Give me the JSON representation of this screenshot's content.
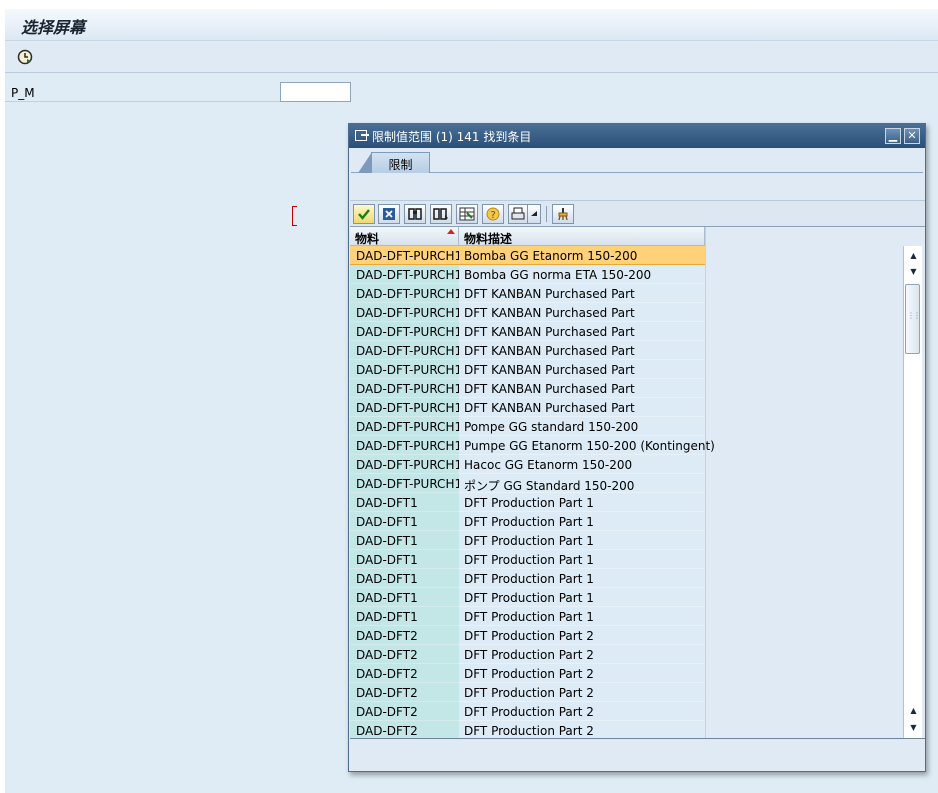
{
  "screen": {
    "title": "选择屏幕",
    "field_label": "P_M",
    "field_value": ""
  },
  "dialog": {
    "title": "限制值范围 (1)  141 找到条目",
    "tab_label": "限制",
    "columns": [
      "物料",
      "物料描述"
    ],
    "rows": [
      {
        "material": "DAD-DFT-PURCH1",
        "description": "Bomba GG Etanorm 150-200"
      },
      {
        "material": "DAD-DFT-PURCH1",
        "description": "Bomba GG norma ETA 150-200"
      },
      {
        "material": "DAD-DFT-PURCH1",
        "description": "DFT KANBAN Purchased Part"
      },
      {
        "material": "DAD-DFT-PURCH1",
        "description": "DFT KANBAN Purchased Part"
      },
      {
        "material": "DAD-DFT-PURCH1",
        "description": "DFT KANBAN Purchased Part"
      },
      {
        "material": "DAD-DFT-PURCH1",
        "description": "DFT KANBAN Purchased Part"
      },
      {
        "material": "DAD-DFT-PURCH1",
        "description": "DFT KANBAN Purchased Part"
      },
      {
        "material": "DAD-DFT-PURCH1",
        "description": "DFT KANBAN Purchased Part"
      },
      {
        "material": "DAD-DFT-PURCH1",
        "description": "DFT KANBAN Purchased Part"
      },
      {
        "material": "DAD-DFT-PURCH1",
        "description": "Pompe GG standard 150-200"
      },
      {
        "material": "DAD-DFT-PURCH1",
        "description": "Pumpe GG Etanorm 150-200 (Kontingent)"
      },
      {
        "material": "DAD-DFT-PURCH1",
        "description": "Hacoc GG Etanorm 150-200"
      },
      {
        "material": "DAD-DFT-PURCH1",
        "description": "ポンプ GG Standard 150-200"
      },
      {
        "material": "DAD-DFT1",
        "description": "DFT Production Part 1"
      },
      {
        "material": "DAD-DFT1",
        "description": "DFT Production Part 1"
      },
      {
        "material": "DAD-DFT1",
        "description": "DFT Production Part 1"
      },
      {
        "material": "DAD-DFT1",
        "description": "DFT Production Part 1"
      },
      {
        "material": "DAD-DFT1",
        "description": "DFT Production Part 1"
      },
      {
        "material": "DAD-DFT1",
        "description": "DFT Production Part 1"
      },
      {
        "material": "DAD-DFT1",
        "description": "DFT Production Part 1"
      },
      {
        "material": "DAD-DFT2",
        "description": "DFT Production Part 2"
      },
      {
        "material": "DAD-DFT2",
        "description": "DFT Production Part 2"
      },
      {
        "material": "DAD-DFT2",
        "description": "DFT Production Part 2"
      },
      {
        "material": "DAD-DFT2",
        "description": "DFT Production Part 2"
      },
      {
        "material": "DAD-DFT2",
        "description": "DFT Production Part 2"
      },
      {
        "material": "DAD-DFT2",
        "description": "DFT Production Part 2"
      }
    ],
    "selected_row": 0,
    "toolbar_icons": [
      "checkmark-icon",
      "cancel-icon",
      "find-icon",
      "find-next-icon",
      "select-layout-icon",
      "help-icon",
      "print-icon",
      "print-dropdown-icon",
      "settings-icon"
    ]
  },
  "colors": {
    "key_column": "#c3e6e6",
    "selected_row": "#ffd27a",
    "dialog_title": "#2b4f78",
    "background": "#dfeaf5"
  }
}
